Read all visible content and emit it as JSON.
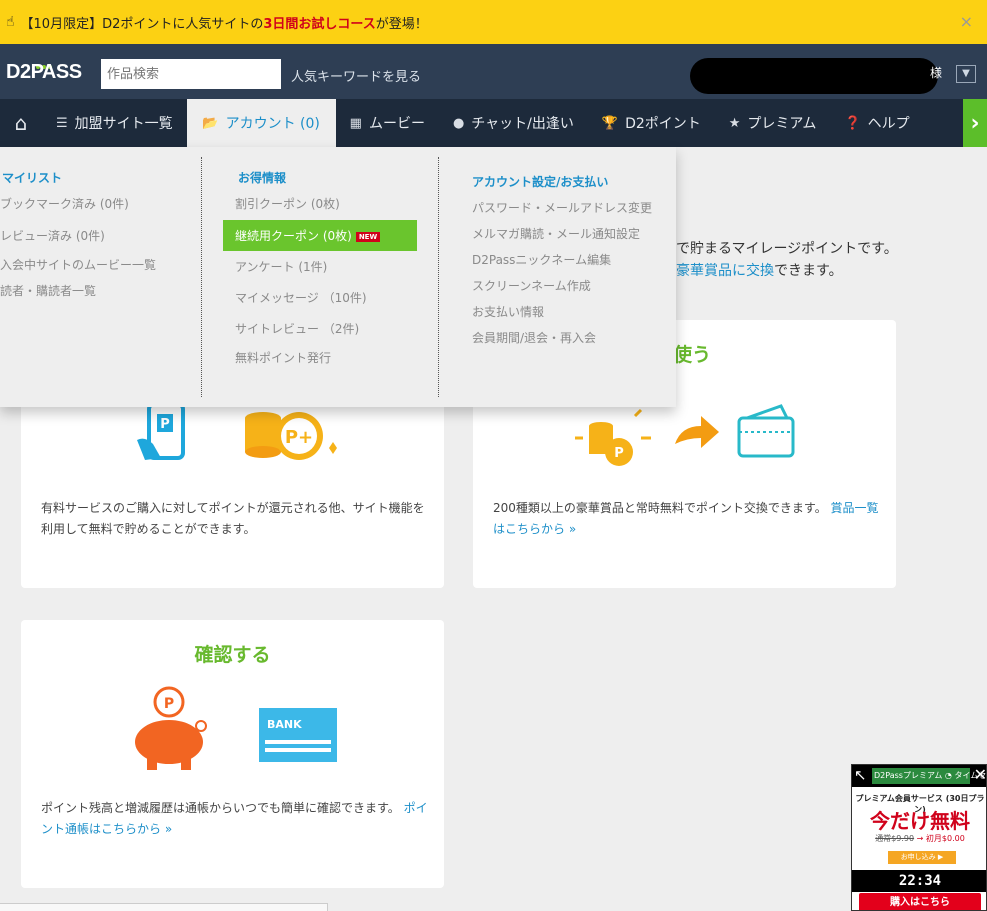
{
  "banner": {
    "pre": "【10月限定】D2ポイントに人気サイトの",
    "highlight": "3日間お試しコース",
    "post": "が登場！",
    "close": "×"
  },
  "header": {
    "logo": "D2PASS",
    "search_placeholder": "作品検索",
    "popular_keywords": "人気キーワードを見る",
    "user_suffix": "様"
  },
  "nav": {
    "sites": "加盟サイト一覧",
    "account": "アカウント (0)",
    "movie": "ムービー",
    "chat": "チャット/出逢い",
    "points": "D2ポイント",
    "premium": "プレミアム",
    "help": "ヘルプ"
  },
  "dropdown": {
    "col1": {
      "head": "マイリスト",
      "items": [
        "ブックマーク済み (0件)",
        "レビュー済み (0件)",
        "入会中サイトのムービー一覧",
        "読者・購読者一覧"
      ]
    },
    "col2": {
      "head": "お得情報",
      "items": [
        "割引クーポン (0枚)",
        "継続用クーポン (0枚)",
        "アンケート (1件)",
        "マイメッセージ （10件)",
        "サイトレビュー （2件)",
        "無料ポイント発行"
      ],
      "new_badge": "NEW"
    },
    "col3": {
      "head": "アカウント設定/お支払い",
      "items": [
        "パスワード・メールアドレス変更",
        "メルマガ購読・メール通知設定",
        "D2Passニックネーム編集",
        "スクリーンネーム作成",
        "お支払い情報",
        "会員期間/退会・再入会"
      ]
    }
  },
  "content": {
    "intro_line1": "で貯まるマイレージポイントです。",
    "intro_link": "豪華賞品に交換",
    "intro_line2_post": "できます。",
    "card_use_title_tail": "使う",
    "card_earn_desc": "有料サービスのご購入に対してポイントが還元される他、サイト機能を利用して無料で貯めることができます。",
    "card_use_desc": "200種類以上の豪華賞品と常時無料でポイント交換できます。",
    "card_use_link": "賞品一覧はこちらから »",
    "card_check_title": "確認する",
    "bank_label": "BANK",
    "card_check_desc": "ポイント残高と増減履歴は通帳からいつでも簡単に確認できます。",
    "card_check_link": "ポイント通帳はこちらから »"
  },
  "ad": {
    "bar": "D2Passプレミアム ◔ タイムセール",
    "sub": "プレミアム会員サービス (30日プラン)",
    "big": "今だけ無料",
    "old_price": "通常$9.90",
    "new_price": "→ 初月$0.00",
    "apply": "お申し込み ▶",
    "timer": "22:34",
    "buy": "購入はこちら"
  },
  "colors": {
    "accent": "#1d8fc9",
    "green": "#6ac52d",
    "nav_bg": "#1d2a3b",
    "header_bg": "#2e3e54",
    "banner_bg": "#fcd113"
  }
}
